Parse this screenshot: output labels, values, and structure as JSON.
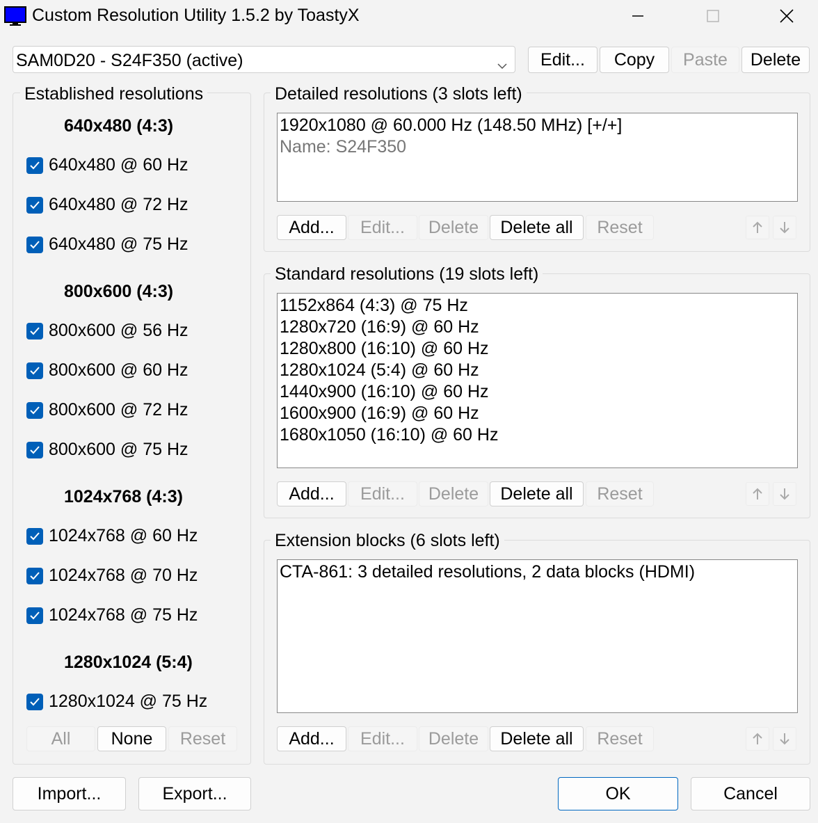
{
  "window": {
    "title": "Custom Resolution Utility 1.5.2 by ToastyX",
    "icons": {
      "app": "monitor-icon",
      "minimize": "minimize-icon",
      "maximize": "maximize-icon",
      "close": "close-icon"
    }
  },
  "monitor": {
    "selected": "SAM0D20 - S24F350 (active)",
    "buttons": {
      "edit": "Edit...",
      "copy": "Copy",
      "paste": "Paste",
      "delete": "Delete"
    }
  },
  "established": {
    "label": "Established resolutions",
    "groups": [
      {
        "header": "640x480 (4:3)",
        "items": [
          "640x480 @ 60 Hz",
          "640x480 @ 72 Hz",
          "640x480 @ 75 Hz"
        ]
      },
      {
        "header": "800x600 (4:3)",
        "items": [
          "800x600 @ 56 Hz",
          "800x600 @ 60 Hz",
          "800x600 @ 72 Hz",
          "800x600 @ 75 Hz"
        ]
      },
      {
        "header": "1024x768 (4:3)",
        "items": [
          "1024x768 @ 60 Hz",
          "1024x768 @ 70 Hz",
          "1024x768 @ 75 Hz"
        ]
      },
      {
        "header": "1280x1024 (5:4)",
        "items": [
          "1280x1024 @ 75 Hz"
        ]
      }
    ],
    "buttons": {
      "all": "All",
      "none": "None",
      "reset": "Reset"
    }
  },
  "detailed": {
    "label": "Detailed resolutions (3 slots left)",
    "items": [
      "1920x1080 @ 60.000 Hz (148.50 MHz) [+/+]"
    ],
    "sub": "Name: S24F350"
  },
  "standard": {
    "label": "Standard resolutions (19 slots left)",
    "items": [
      "1152x864 (4:3) @ 75 Hz",
      "1280x720 (16:9) @ 60 Hz",
      "1280x800 (16:10) @ 60 Hz",
      "1280x1024 (5:4) @ 60 Hz",
      "1440x900 (16:10) @ 60 Hz",
      "1600x900 (16:9) @ 60 Hz",
      "1680x1050 (16:10) @ 60 Hz"
    ]
  },
  "extension": {
    "label": "Extension blocks (6 slots left)",
    "items": [
      "CTA-861: 3 detailed resolutions, 2 data blocks (HDMI)"
    ]
  },
  "list_buttons": {
    "add": "Add...",
    "edit": "Edit...",
    "delete": "Delete",
    "delete_all": "Delete all",
    "reset": "Reset"
  },
  "footer": {
    "import": "Import...",
    "export": "Export...",
    "ok": "OK",
    "cancel": "Cancel"
  },
  "colors": {
    "checkbox": "#005fb8",
    "accent_border": "#0067c0",
    "disabled_text": "#9b9b9b"
  }
}
